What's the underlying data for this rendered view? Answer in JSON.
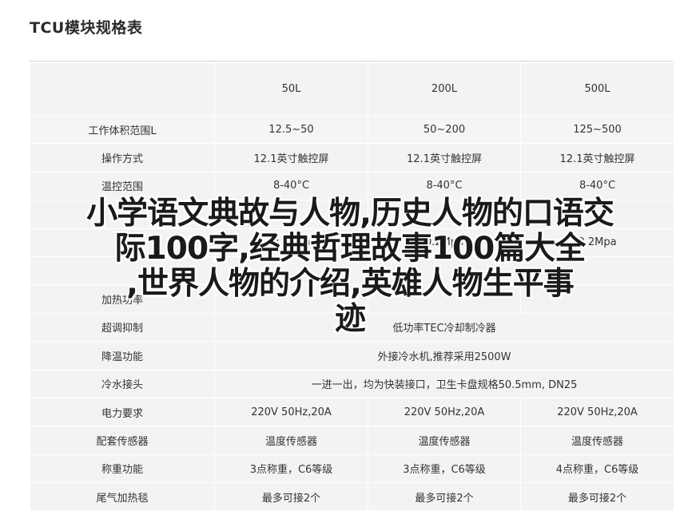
{
  "page": {
    "title": "TCU模块规格表"
  },
  "table": {
    "header": [
      "",
      "50L",
      "200L",
      "500L"
    ],
    "rows": [
      {
        "label": "工作体积范围L",
        "values": [
          "12.5~50",
          "50~200",
          "125~500"
        ]
      },
      {
        "label": "操作方式",
        "values": [
          "12.1英寸触控屏",
          "12.1英寸触控屏",
          "12.1英寸触控屏"
        ]
      },
      {
        "label": "温控范围",
        "values": [
          "8-40°C",
          "8-40°C",
          "8-40°C"
        ]
      },
      {
        "label": "",
        "values": [
          "",
          "",
          ""
        ]
      },
      {
        "label": "",
        "values": [
          "0.2Mpa",
          "0.2Mpa",
          "0.2Mpa"
        ]
      },
      {
        "label": "",
        "values": [
          "",
          "",
          ""
        ]
      },
      {
        "label": "加热功率",
        "values": [
          "",
          "",
          ""
        ]
      },
      {
        "label": "超调抑制",
        "values": [
          "低功率TEC冷却制冷器"
        ]
      },
      {
        "label": "降温功能",
        "values": [
          "外接冷水机,推荐采用2500W"
        ]
      },
      {
        "label": "冷水接头",
        "values": [
          "一进一出，均为快装接口，卫生卡盘规格50.5mm, DN25"
        ]
      },
      {
        "label": "电力要求",
        "values": [
          "220V 50Hz,20A",
          "220V 50Hz,20A",
          "220V 50Hz,20A"
        ]
      },
      {
        "label": "配套传感器",
        "values": [
          "温度传感器",
          "温度传感器",
          "温度传感器"
        ]
      },
      {
        "label": "称重功能",
        "values": [
          "3点称重，C6等级",
          "3点称重，C6等级",
          "4点称重，C6等级"
        ]
      },
      {
        "label": "尾气加热毯",
        "values": [
          "最多可接2个",
          "最多可接2个",
          "最多可接2个"
        ]
      }
    ]
  },
  "overlay": {
    "line1": "小学语文典故与人物,历史人物的口语交",
    "line2": "际100字,经典哲理故事100篇大全",
    "line3": ",世界人物的介绍,英雄人物生平事",
    "line4": "迹"
  }
}
